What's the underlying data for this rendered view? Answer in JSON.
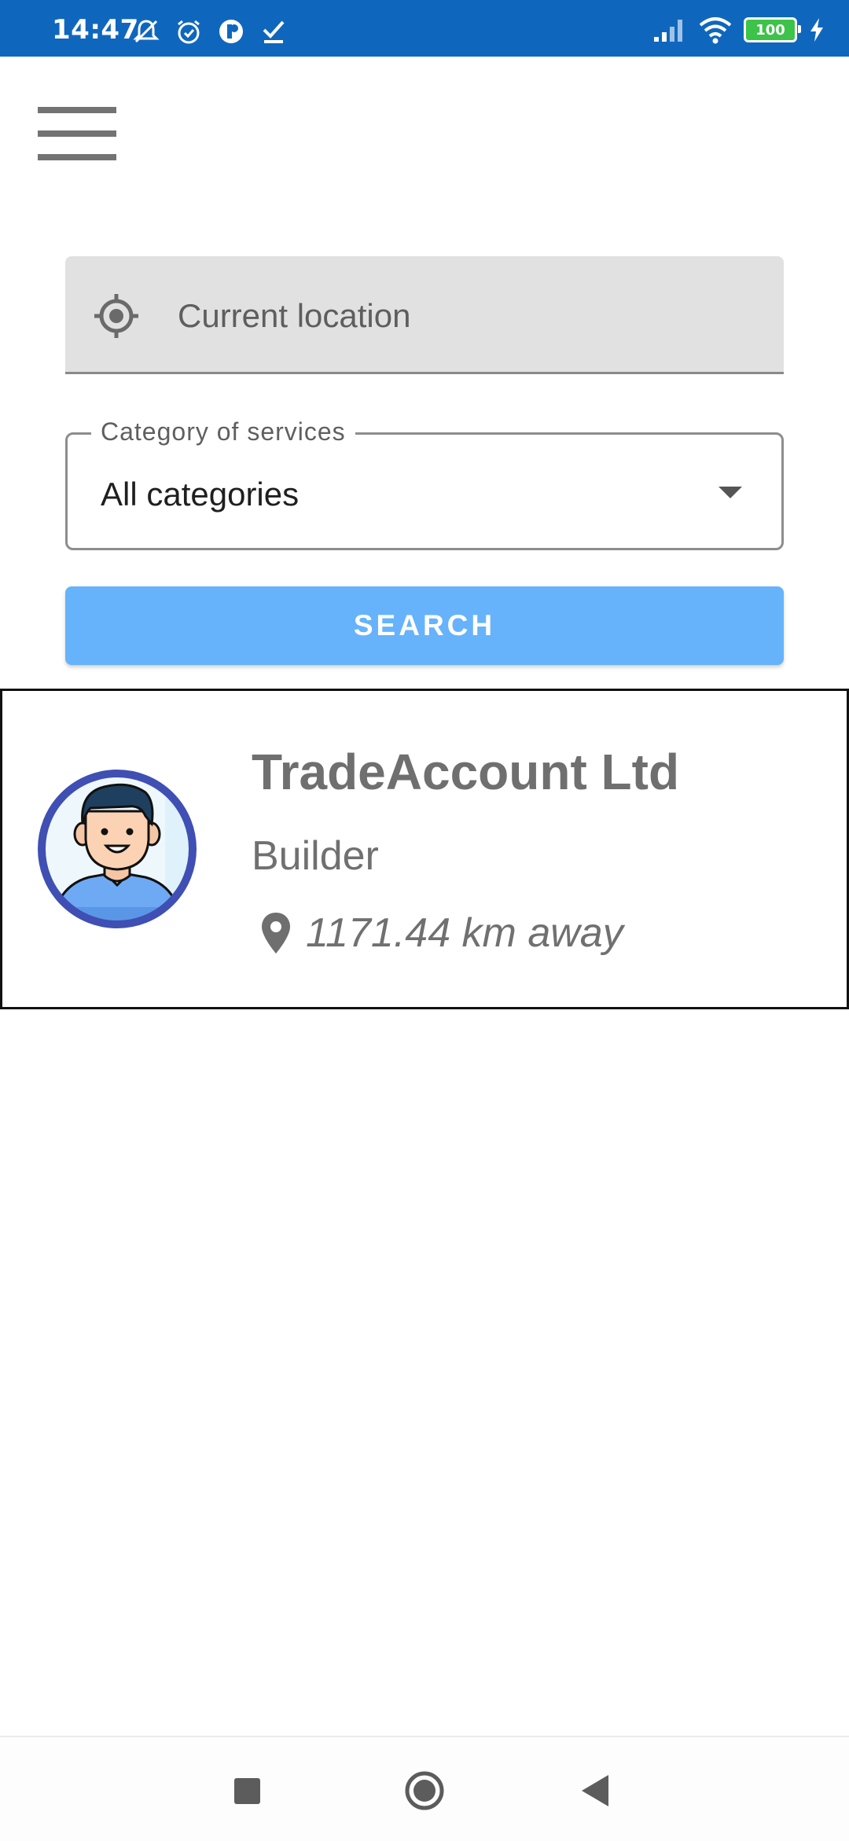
{
  "status_bar": {
    "time": "14:47",
    "battery_level": "100",
    "icons": [
      "mute-icon",
      "alarm-icon",
      "app-icon",
      "check-icon",
      "signal-icon",
      "wifi-icon",
      "battery-icon",
      "charging-icon"
    ]
  },
  "header": {
    "menu_icon": "hamburger-menu-icon"
  },
  "search_form": {
    "location_placeholder": "Current location",
    "category_label": "Category of services",
    "category_value": "All categories",
    "search_button": "SEARCH"
  },
  "results": [
    {
      "name": "TradeAccount Ltd",
      "role": "Builder",
      "distance": "1171.44 km away"
    }
  ],
  "colors": {
    "status_bar": "#0f67bd",
    "search_button": "#66b3fb",
    "avatar_ring": "#3f4fb3"
  }
}
